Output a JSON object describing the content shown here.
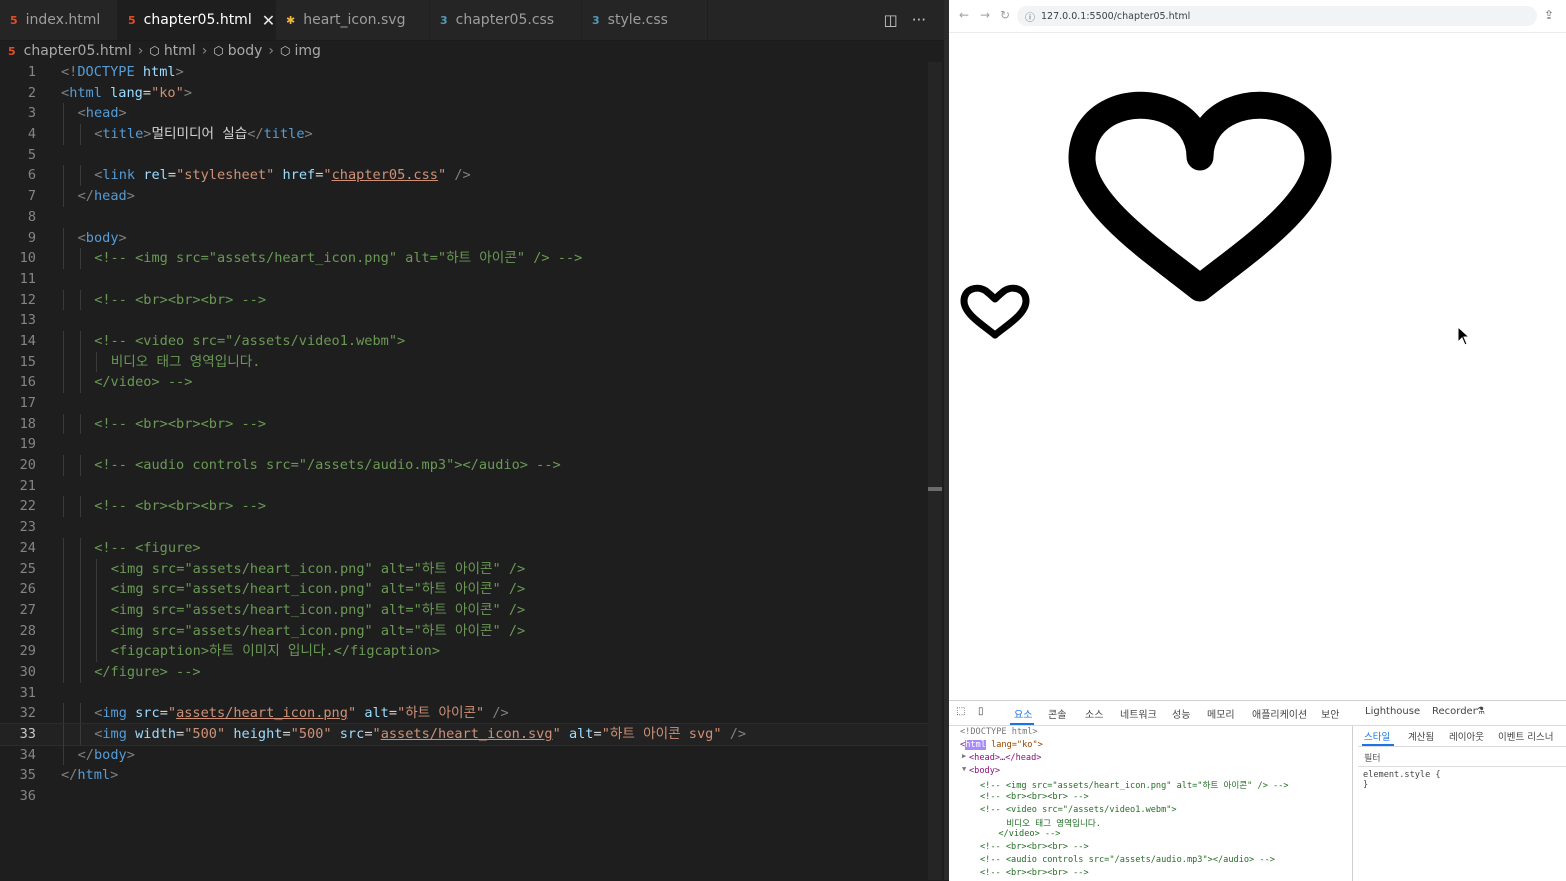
{
  "editor": {
    "tabs": [
      {
        "label": "index.html",
        "icon": "html-file-icon"
      },
      {
        "label": "chapter05.html",
        "icon": "html-file-icon",
        "active": true
      },
      {
        "label": "heart_icon.svg",
        "icon": "svg-file-icon"
      },
      {
        "label": "chapter05.css",
        "icon": "css-file-icon"
      },
      {
        "label": "style.css",
        "icon": "css-file-icon"
      }
    ],
    "breadcrumb": [
      "chapter05.html",
      "html",
      "body",
      "img"
    ],
    "current_line": 33,
    "lines": [
      {
        "n": "1",
        "indent": 0,
        "tokens": [
          [
            "p",
            "<!"
          ],
          [
            "t",
            "DOCTYPE"
          ],
          [
            "x",
            " "
          ],
          [
            "a",
            "html"
          ],
          [
            "p",
            ">"
          ]
        ]
      },
      {
        "n": "2",
        "indent": 0,
        "tokens": [
          [
            "p",
            "<"
          ],
          [
            "t",
            "html"
          ],
          [
            "x",
            " "
          ],
          [
            "a",
            "lang"
          ],
          [
            "x",
            "="
          ],
          [
            "v",
            "\"ko\""
          ],
          [
            "p",
            ">"
          ]
        ]
      },
      {
        "n": "3",
        "indent": 1,
        "tokens": [
          [
            "p",
            "<"
          ],
          [
            "t",
            "head"
          ],
          [
            "p",
            ">"
          ]
        ]
      },
      {
        "n": "4",
        "indent": 2,
        "tokens": [
          [
            "p",
            "<"
          ],
          [
            "t",
            "title"
          ],
          [
            "p",
            ">"
          ],
          [
            "x",
            "멀티미디어 실습"
          ],
          [
            "p",
            "</"
          ],
          [
            "t",
            "title"
          ],
          [
            "p",
            ">"
          ]
        ]
      },
      {
        "n": "5",
        "indent": 0,
        "tokens": []
      },
      {
        "n": "6",
        "indent": 2,
        "tokens": [
          [
            "p",
            "<"
          ],
          [
            "t",
            "link"
          ],
          [
            "x",
            " "
          ],
          [
            "a",
            "rel"
          ],
          [
            "x",
            "="
          ],
          [
            "v",
            "\"stylesheet\""
          ],
          [
            "x",
            " "
          ],
          [
            "a",
            "href"
          ],
          [
            "x",
            "="
          ],
          [
            "v",
            "\""
          ],
          [
            "vu",
            "chapter05.css"
          ],
          [
            "v",
            "\""
          ],
          [
            "x",
            " "
          ],
          [
            "p",
            "/>"
          ]
        ]
      },
      {
        "n": "7",
        "indent": 1,
        "tokens": [
          [
            "p",
            "</"
          ],
          [
            "t",
            "head"
          ],
          [
            "p",
            ">"
          ]
        ]
      },
      {
        "n": "8",
        "indent": 0,
        "tokens": []
      },
      {
        "n": "9",
        "indent": 1,
        "tokens": [
          [
            "p",
            "<"
          ],
          [
            "t",
            "body"
          ],
          [
            "p",
            ">"
          ]
        ]
      },
      {
        "n": "10",
        "indent": 2,
        "tokens": [
          [
            "c",
            "<!-- <img src=\"assets/heart_icon.png\" alt=\"하트 아이콘\" /> -->"
          ]
        ]
      },
      {
        "n": "11",
        "indent": 0,
        "tokens": []
      },
      {
        "n": "12",
        "indent": 2,
        "tokens": [
          [
            "c",
            "<!-- <br><br><br> -->"
          ]
        ]
      },
      {
        "n": "13",
        "indent": 0,
        "tokens": []
      },
      {
        "n": "14",
        "indent": 2,
        "tokens": [
          [
            "c",
            "<!-- <video src=\"/assets/video1.webm\">"
          ]
        ]
      },
      {
        "n": "15",
        "indent": 3,
        "tokens": [
          [
            "c",
            "비디오 태그 영역입니다."
          ]
        ]
      },
      {
        "n": "16",
        "indent": 2,
        "tokens": [
          [
            "c",
            "</video> -->"
          ]
        ]
      },
      {
        "n": "17",
        "indent": 0,
        "tokens": []
      },
      {
        "n": "18",
        "indent": 2,
        "tokens": [
          [
            "c",
            "<!-- <br><br><br> -->"
          ]
        ]
      },
      {
        "n": "19",
        "indent": 0,
        "tokens": []
      },
      {
        "n": "20",
        "indent": 2,
        "tokens": [
          [
            "c",
            "<!-- <audio controls src=\"/assets/audio.mp3\"></audio> -->"
          ]
        ]
      },
      {
        "n": "21",
        "indent": 0,
        "tokens": []
      },
      {
        "n": "22",
        "indent": 2,
        "tokens": [
          [
            "c",
            "<!-- <br><br><br> -->"
          ]
        ]
      },
      {
        "n": "23",
        "indent": 0,
        "tokens": []
      },
      {
        "n": "24",
        "indent": 2,
        "tokens": [
          [
            "c",
            "<!-- <figure>"
          ]
        ]
      },
      {
        "n": "25",
        "indent": 3,
        "tokens": [
          [
            "c",
            "<img src=\"assets/heart_icon.png\" alt=\"하트 아이콘\" />"
          ]
        ]
      },
      {
        "n": "26",
        "indent": 3,
        "tokens": [
          [
            "c",
            "<img src=\"assets/heart_icon.png\" alt=\"하트 아이콘\" />"
          ]
        ]
      },
      {
        "n": "27",
        "indent": 3,
        "tokens": [
          [
            "c",
            "<img src=\"assets/heart_icon.png\" alt=\"하트 아이콘\" />"
          ]
        ]
      },
      {
        "n": "28",
        "indent": 3,
        "tokens": [
          [
            "c",
            "<img src=\"assets/heart_icon.png\" alt=\"하트 아이콘\" />"
          ]
        ]
      },
      {
        "n": "29",
        "indent": 3,
        "tokens": [
          [
            "c",
            "<figcaption>하트 이미지 입니다.</figcaption>"
          ]
        ]
      },
      {
        "n": "30",
        "indent": 2,
        "tokens": [
          [
            "c",
            "</figure> -->"
          ]
        ]
      },
      {
        "n": "31",
        "indent": 0,
        "tokens": []
      },
      {
        "n": "32",
        "indent": 2,
        "tokens": [
          [
            "p",
            "<"
          ],
          [
            "t",
            "img"
          ],
          [
            "x",
            " "
          ],
          [
            "a",
            "src"
          ],
          [
            "x",
            "="
          ],
          [
            "v",
            "\""
          ],
          [
            "vu",
            "assets/heart_icon.png"
          ],
          [
            "v",
            "\""
          ],
          [
            "x",
            " "
          ],
          [
            "a",
            "alt"
          ],
          [
            "x",
            "="
          ],
          [
            "v",
            "\"하트 아이콘\""
          ],
          [
            "x",
            " "
          ],
          [
            "p",
            "/>"
          ]
        ]
      },
      {
        "n": "33",
        "indent": 2,
        "tokens": [
          [
            "p",
            "<"
          ],
          [
            "t",
            "img"
          ],
          [
            "x",
            " "
          ],
          [
            "a",
            "width"
          ],
          [
            "x",
            "="
          ],
          [
            "v",
            "\"500\""
          ],
          [
            "x",
            " "
          ],
          [
            "a",
            "height"
          ],
          [
            "x",
            "="
          ],
          [
            "v",
            "\"500\""
          ],
          [
            "x",
            " "
          ],
          [
            "a",
            "src"
          ],
          [
            "x",
            "="
          ],
          [
            "v",
            "\""
          ],
          [
            "vu",
            "assets/heart_icon.svg"
          ],
          [
            "v",
            "\""
          ],
          [
            "x",
            " "
          ],
          [
            "a",
            "alt"
          ],
          [
            "x",
            "="
          ],
          [
            "v",
            "\"하트 아이콘 svg\""
          ],
          [
            "x",
            " "
          ],
          [
            "p",
            "/>"
          ]
        ]
      },
      {
        "n": "34",
        "indent": 1,
        "tokens": [
          [
            "p",
            "</"
          ],
          [
            "t",
            "body"
          ],
          [
            "p",
            ">"
          ]
        ]
      },
      {
        "n": "35",
        "indent": 0,
        "tokens": [
          [
            "p",
            "</"
          ],
          [
            "t",
            "html"
          ],
          [
            "p",
            ">"
          ]
        ]
      },
      {
        "n": "36",
        "indent": 0,
        "tokens": []
      }
    ]
  },
  "browser": {
    "url": "127.0.0.1:5500/chapter05.html"
  },
  "devtools": {
    "tabs": [
      "요소",
      "콘솔",
      "소스",
      "네트워크",
      "성능",
      "메모리",
      "애플리케이션",
      "보안",
      "Lighthouse",
      "Recorder"
    ],
    "active_tab": "요소",
    "elements": {
      "doctype": "<!DOCTYPE html>",
      "html_tag": "html",
      "html_attr": " lang=\"ko\">",
      "head": "<head>…</head>",
      "body": "<body>",
      "lines": [
        "<!-- <img src=\"assets/heart_icon.png\" alt=\"하트 아이콘\" /> -->",
        "<!-- <br><br><br> -->",
        "<!-- <video src=\"/assets/video1.webm\">",
        "  비디오 태그 영역입니다.",
        "  </video> -->",
        "<!-- <br><br><br> -->",
        "<!-- <audio controls src=\"/assets/audio.mp3\"></audio> -->",
        "<!-- <br><br><br> -->"
      ]
    },
    "styles_tabs": [
      "스타일",
      "계산됨",
      "레이아웃",
      "이벤트 리스너"
    ],
    "filter_placeholder": "필터",
    "element_style": "element.style {\n}"
  }
}
